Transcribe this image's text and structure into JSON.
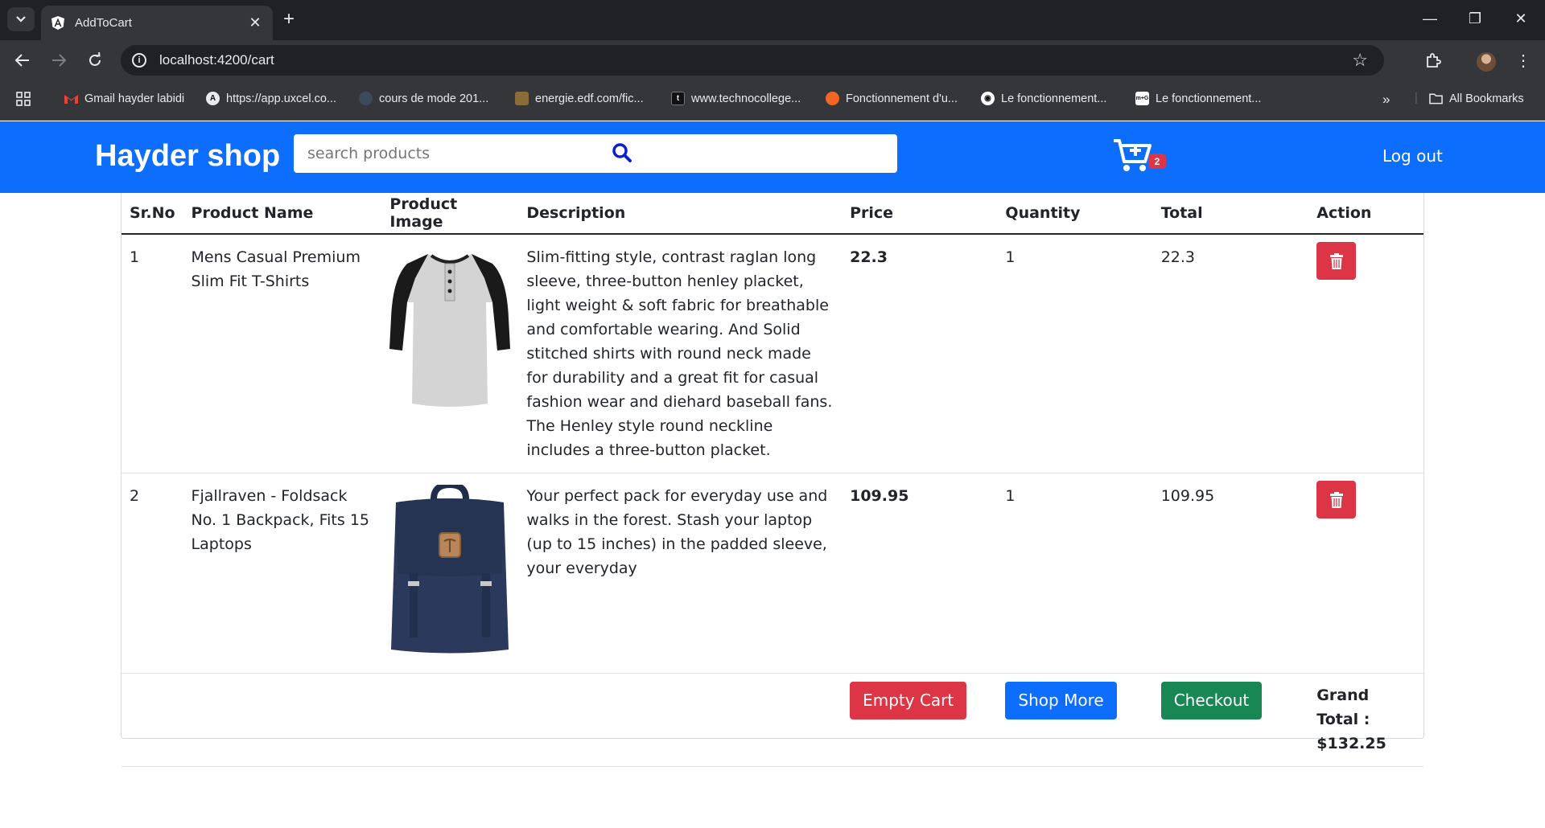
{
  "browser": {
    "tab_title": "AddToCart",
    "url": "localhost:4200/cart",
    "bookmarks": [
      {
        "label": "Gmail hayder labidi",
        "icon": "gmail-icon",
        "color": "#ea4335"
      },
      {
        "label": "https://app.uxcel.co...",
        "icon": "uxcel-icon",
        "color": "#111111"
      },
      {
        "label": "cours de mode 201...",
        "icon": "globe-icon",
        "color": "#3c4a5c"
      },
      {
        "label": "energie.edf.com/fic...",
        "icon": "edf-icon",
        "color": "#8a6b3c"
      },
      {
        "label": "www.technocollege...",
        "icon": "technocollege-icon",
        "color": "#111111"
      },
      {
        "label": "Fonctionnement d'u...",
        "icon": "orange-site-icon",
        "color": "#f26522"
      },
      {
        "label": "Le fonctionnement...",
        "icon": "radio-icon",
        "color": "#ffffff"
      },
      {
        "label": "Le fonctionnement...",
        "icon": "mg-icon",
        "color": "#ffffff"
      }
    ],
    "all_bookmarks": "All Bookmarks"
  },
  "navbar": {
    "brand": "Hayder shop",
    "search_placeholder": "search products",
    "cart_count": "2",
    "logout": "Log out"
  },
  "table": {
    "headers": [
      "Sr.No",
      "Product Name",
      "Product Image",
      "Description",
      "Price",
      "Quantity",
      "Total",
      "Action"
    ],
    "rows": [
      {
        "sr": "1",
        "name": "Mens Casual Premium Slim Fit T-Shirts",
        "image": "tshirt-image",
        "description": "Slim-fitting style, contrast raglan long sleeve, three-button henley placket, light weight & soft fabric for breathable and comfortable wearing. And Solid stitched shirts with round neck made for durability and a great fit for casual fashion wear and diehard baseball fans. The Henley style round neckline includes a three-button placket.",
        "price": "22.3",
        "quantity": "1",
        "total": "22.3"
      },
      {
        "sr": "2",
        "name": "Fjallraven - Foldsack No. 1 Backpack, Fits 15 Laptops",
        "image": "backpack-image",
        "description": "Your perfect pack for everyday use and walks in the forest. Stash your laptop (up to 15 inches) in the padded sleeve, your everyday",
        "price": "109.95",
        "quantity": "1",
        "total": "109.95"
      }
    ]
  },
  "footer_actions": {
    "empty_cart": "Empty Cart",
    "shop_more": "Shop More",
    "checkout": "Checkout",
    "grand_total_label": "Grand Total :",
    "grand_total_value": "$132.25"
  },
  "colors": {
    "navbar": "#0d6efd",
    "danger": "#dc3545",
    "success": "#198754"
  }
}
